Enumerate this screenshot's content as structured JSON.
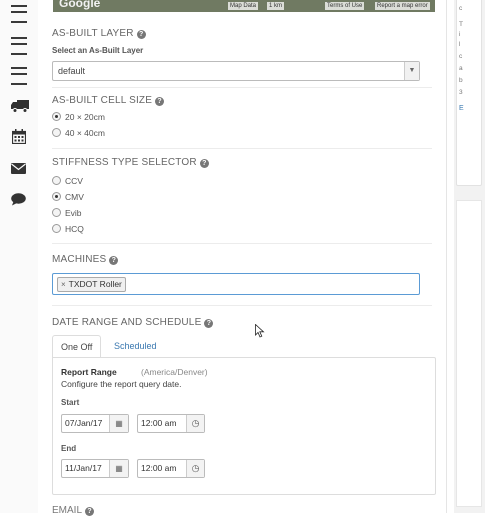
{
  "map": {
    "brand": "Google",
    "map_data": "Map Data",
    "scale": "1 km",
    "terms": "Terms of Use",
    "report": "Report a map error"
  },
  "sidebar": {
    "icons": [
      "server-icon",
      "server-icon",
      "server-icon",
      "truck-icon",
      "calendar-icon",
      "envelope-icon",
      "comment-icon"
    ]
  },
  "as_built_layer": {
    "title": "AS-BUILT LAYER",
    "select_label": "Select an As-Built Layer",
    "selected": "default"
  },
  "cell_size": {
    "title": "AS-BUILT CELL SIZE",
    "options": [
      "20 × 20cm",
      "40 × 40cm"
    ],
    "selected": "20 × 20cm"
  },
  "stiffness": {
    "title": "STIFFNESS TYPE SELECTOR",
    "options": [
      "CCV",
      "CMV",
      "Evib",
      "HCQ"
    ],
    "selected": "CMV"
  },
  "machines": {
    "title": "MACHINES",
    "tags": [
      "TXDOT Roller"
    ]
  },
  "date_range": {
    "title": "DATE RANGE AND SCHEDULE",
    "tabs": [
      "One Off",
      "Scheduled"
    ],
    "active_tab": "One Off",
    "report_range_label": "Report Range",
    "timezone": "(America/Denver)",
    "description": "Configure the report query date.",
    "start_label": "Start",
    "start_date": "07/Jan/17",
    "start_time": "12:00 am",
    "end_label": "End",
    "end_date": "11/Jan/17",
    "end_time": "12:00 am"
  },
  "email": {
    "title": "EMAIL"
  },
  "right_pane": {
    "lines": [
      "c",
      "T",
      "i",
      "l",
      "c",
      "a",
      "b",
      "3"
    ],
    "link": "E"
  }
}
